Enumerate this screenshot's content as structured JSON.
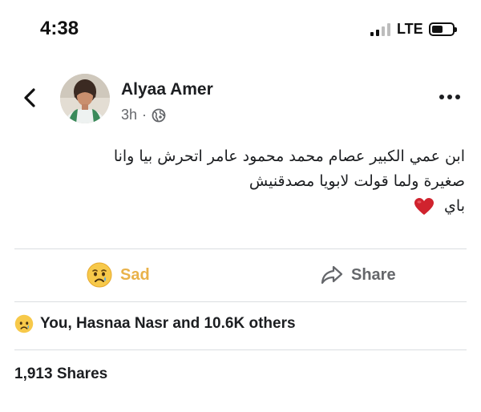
{
  "status_bar": {
    "time": "4:38",
    "network": "LTE",
    "signal_bars_filled": 2,
    "signal_bars_total": 4
  },
  "header": {
    "back_icon": "chevron-left-icon",
    "more_icon": "ellipsis-icon"
  },
  "post": {
    "author": "Alyaa Amer",
    "time_ago": "3h",
    "separator": "·",
    "audience_icon": "globe-icon",
    "text_lines": [
      "ابن عمي الكبير عصام محمد محمود عامر اتحرش بيا وانا",
      "صغيرة  ولما قولت لابويا مصدقنيش",
      "باي"
    ],
    "emoji": "heart-icon"
  },
  "actions": {
    "reaction_label": "Sad",
    "reaction_icon": "sad-face-icon",
    "share_label": "Share",
    "share_icon": "share-arrow-icon"
  },
  "summary": {
    "reactions_text": "You, Hasnaa Nasr and 10.6K others",
    "shares_text": "1,913 Shares"
  },
  "colors": {
    "sad_accent": "#e9b24a",
    "secondary_text": "#65676b",
    "primary_text": "#1c1e21",
    "heart": "#d0232e",
    "divider": "#dadde1"
  }
}
